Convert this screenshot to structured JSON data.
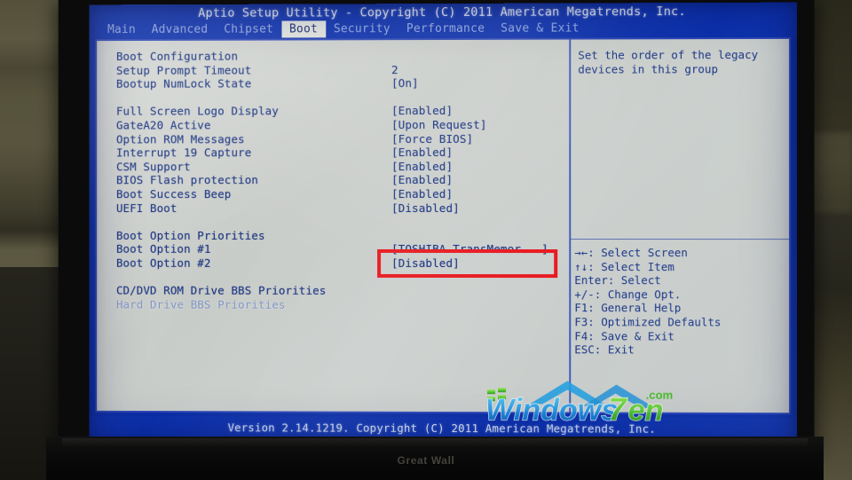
{
  "window": {
    "title": "Aptio Setup Utility - Copyright (C) 2011 American Megatrends, Inc.",
    "footer": "Version 2.14.1219. Copyright (C) 2011 American Megatrends, Inc."
  },
  "tabs": [
    {
      "label": "Main",
      "active": false
    },
    {
      "label": "Advanced",
      "active": false
    },
    {
      "label": "Chipset",
      "active": false
    },
    {
      "label": "Boot",
      "active": true
    },
    {
      "label": "Security",
      "active": false
    },
    {
      "label": "Performance",
      "active": false
    },
    {
      "label": "Save & Exit",
      "active": false
    }
  ],
  "settings": [
    {
      "kind": "header",
      "label": "Boot Configuration",
      "value": ""
    },
    {
      "kind": "item",
      "label": "Setup Prompt Timeout",
      "value": "2"
    },
    {
      "kind": "item",
      "label": "Bootup NumLock State",
      "value": "[On]"
    },
    {
      "kind": "spacer",
      "label": "",
      "value": ""
    },
    {
      "kind": "item",
      "label": "Full Screen Logo Display",
      "value": "[Enabled]"
    },
    {
      "kind": "item",
      "label": "GateA20 Active",
      "value": "[Upon Request]"
    },
    {
      "kind": "item",
      "label": "Option ROM Messages",
      "value": "[Force BIOS]"
    },
    {
      "kind": "item",
      "label": "Interrupt 19 Capture",
      "value": "[Enabled]"
    },
    {
      "kind": "item",
      "label": "CSM Support",
      "value": "[Enabled]"
    },
    {
      "kind": "item",
      "label": "BIOS Flash protection",
      "value": "[Enabled]"
    },
    {
      "kind": "item",
      "label": "Boot Success Beep",
      "value": "[Enabled]"
    },
    {
      "kind": "item",
      "label": "UEFI Boot",
      "value": "[Disabled]"
    },
    {
      "kind": "spacer",
      "label": "",
      "value": ""
    },
    {
      "kind": "header",
      "label": "Boot Option Priorities",
      "value": ""
    },
    {
      "kind": "item",
      "label": "Boot Option #1",
      "value": "[TOSHIBA TransMemor...]"
    },
    {
      "kind": "item",
      "label": "Boot Option #2",
      "value": "[Disabled]"
    },
    {
      "kind": "spacer",
      "label": "",
      "value": ""
    },
    {
      "kind": "submenu",
      "label": "CD/DVD ROM Drive BBS Priorities",
      "value": ""
    },
    {
      "kind": "submenu-dim",
      "label": "Hard Drive BBS Priorities",
      "value": ""
    }
  ],
  "help": {
    "text": "Set the order of the legacy\ndevices in this group"
  },
  "keys": [
    {
      "key": "→←",
      "sep": ":",
      "action": " Select Screen"
    },
    {
      "key": "↑↓",
      "sep": ":",
      "action": " Select Item"
    },
    {
      "key": "Enter",
      "sep": ":",
      "action": " Select"
    },
    {
      "key": "+/-",
      "sep": ":",
      "action": " Change Opt."
    },
    {
      "key": "F1",
      "sep": ":",
      "action": " General Help"
    },
    {
      "key": "F3",
      "sep": ":",
      "action": " Optimized Defaults"
    },
    {
      "key": "F4",
      "sep": ":",
      "action": " Save & Exit"
    },
    {
      "key": "ESC",
      "sep": ":",
      "action": " Exit"
    }
  ],
  "annotation": {
    "target": "[TOSHIBA TransMemor...]",
    "color": "#e8171d"
  },
  "watermark": {
    "text_1": "Windows",
    "text_2": "7",
    "text_3": "en",
    "text_4": ".com",
    "color_blue": "#2196e8",
    "color_green": "#4fc62b",
    "color_roof": "#22a0e0"
  },
  "hardware": {
    "brand": "Great Wall"
  },
  "colors": {
    "bios_blue": "#0c31ad",
    "panel_bg": "#c6cac6",
    "panel_border": "#2a46b6",
    "text_blue": "#16307f",
    "tab_active_bg": "#e2e6e0",
    "tab_inactive_text": "#9fb4e8"
  }
}
